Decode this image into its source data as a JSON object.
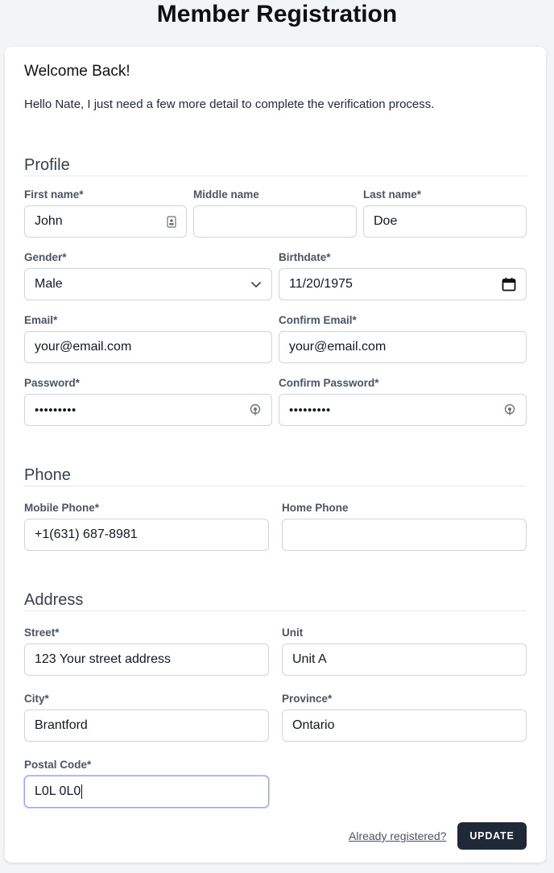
{
  "page": {
    "title": "Member Registration"
  },
  "card": {
    "welcome": "Welcome Back!",
    "intro": "Hello Nate, I just need a few more detail to complete the verification process."
  },
  "profile": {
    "title": "Profile",
    "first_name_label": "First name*",
    "first_name_value": "John",
    "middle_name_label": "Middle name",
    "middle_name_value": "",
    "last_name_label": "Last name*",
    "last_name_value": "Doe",
    "gender_label": "Gender*",
    "gender_value": "Male",
    "birthdate_label": "Birthdate*",
    "birthdate_value": "11/20/1975",
    "email_label": "Email*",
    "email_value": "your@email.com",
    "confirm_email_label": "Confirm Email*",
    "confirm_email_value": "your@email.com",
    "password_label": "Password*",
    "password_value": "•••••••••",
    "confirm_password_label": "Confirm Password*",
    "confirm_password_value": "•••••••••"
  },
  "phone": {
    "title": "Phone",
    "mobile_label": "Mobile Phone*",
    "mobile_value": "+1(631) 687-8981",
    "home_label": "Home Phone",
    "home_value": ""
  },
  "address": {
    "title": "Address",
    "street_label": "Street*",
    "street_value": "123 Your street address",
    "unit_label": "Unit",
    "unit_value": "Unit A",
    "city_label": "City*",
    "city_value": "Brantford",
    "province_label": "Province*",
    "province_value": "Ontario",
    "postal_label": "Postal Code*",
    "postal_value": "L0L 0L0"
  },
  "actions": {
    "already_registered": "Already registered?",
    "update": "UPDATE"
  },
  "icons": {
    "contact_card": "contact-card-icon",
    "chevron_down": "chevron-down-icon",
    "calendar": "calendar-icon",
    "password_reveal": "password-reveal-icon"
  },
  "colors": {
    "button_bg": "#1f2937",
    "focus_border": "#93a4f5"
  }
}
